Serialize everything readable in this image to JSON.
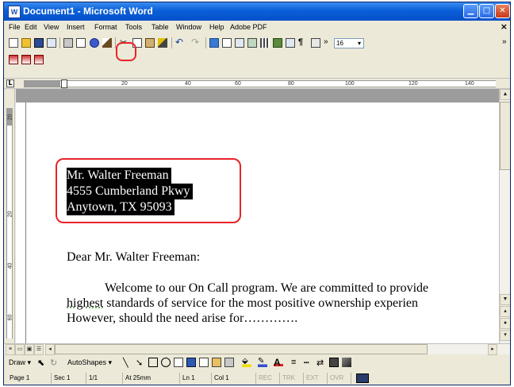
{
  "window": {
    "title": "Document1 - Microsoft Word",
    "app_icon": "W",
    "controls": [
      "minimize",
      "maximize",
      "close"
    ]
  },
  "menu": {
    "items": [
      "File",
      "Edit",
      "View",
      "Insert",
      "Format",
      "Tools",
      "Table",
      "Window",
      "Help",
      "Adobe PDF"
    ],
    "close_document": "×"
  },
  "toolbar": {
    "font_size": "16",
    "font_size_arrow": "▾",
    "chevron": "»",
    "highlighted_tool": "help-circle-icon"
  },
  "ruler": {
    "marks": [
      "20",
      "40",
      "60",
      "80",
      "100",
      "120",
      "140"
    ]
  },
  "vruler": {
    "marks": [
      "20",
      "20",
      "40",
      "60"
    ]
  },
  "document": {
    "address_lines": [
      "Mr. Walter Freeman",
      "4555 Cumberland Pkwy",
      "Anytown, TX 95093"
    ],
    "salutation": "Dear Mr. Walter Freeman:",
    "body_line_1": "Welcome to our On Call program. We are committed to provide",
    "body_line_2_underlined": "highest",
    "body_line_2_rest": " standards of service for the most positive ownership experien",
    "body_line_3": "However, should the need arise for…………."
  },
  "drawing": {
    "draw_label": "Draw",
    "autoshapes_label": "AutoShapes"
  },
  "status": {
    "page": "Page 1",
    "sec": "Sec 1",
    "pages": "1/1",
    "at": "At 25mm",
    "ln": "Ln 1",
    "col": "Col 1",
    "rec": "REC",
    "trk": "TRK",
    "ext": "EXT",
    "ovr": "OVR"
  },
  "colors": {
    "title_blue": "#0a5fd8",
    "highlight_red": "#e8232a",
    "chrome": "#ece9d8"
  }
}
